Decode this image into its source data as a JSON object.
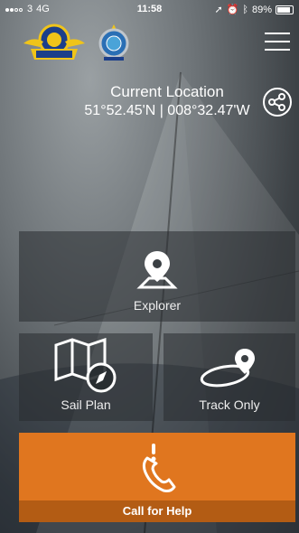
{
  "status_bar": {
    "carrier": "3",
    "network": "4G",
    "time": "11:58",
    "battery": "89%",
    "battery_level": 0.89
  },
  "header": {
    "logo_left_text_top": "Ireland Volunteer",
    "logo_left_text_bottom": "COAST GUARD",
    "logo_right_text": "IRELAND",
    "menu_icon": "hamburger-icon"
  },
  "location": {
    "title": "Current Location",
    "coords": "51°52.45'N | 008°32.47'W",
    "share_icon": "share-icon"
  },
  "tiles": {
    "explorer": "Explorer",
    "sail_plan": "Sail Plan",
    "track_only": "Track Only"
  },
  "help": {
    "label": "Call for Help",
    "icon": "phone-alert-icon",
    "color": "#e0761f"
  }
}
